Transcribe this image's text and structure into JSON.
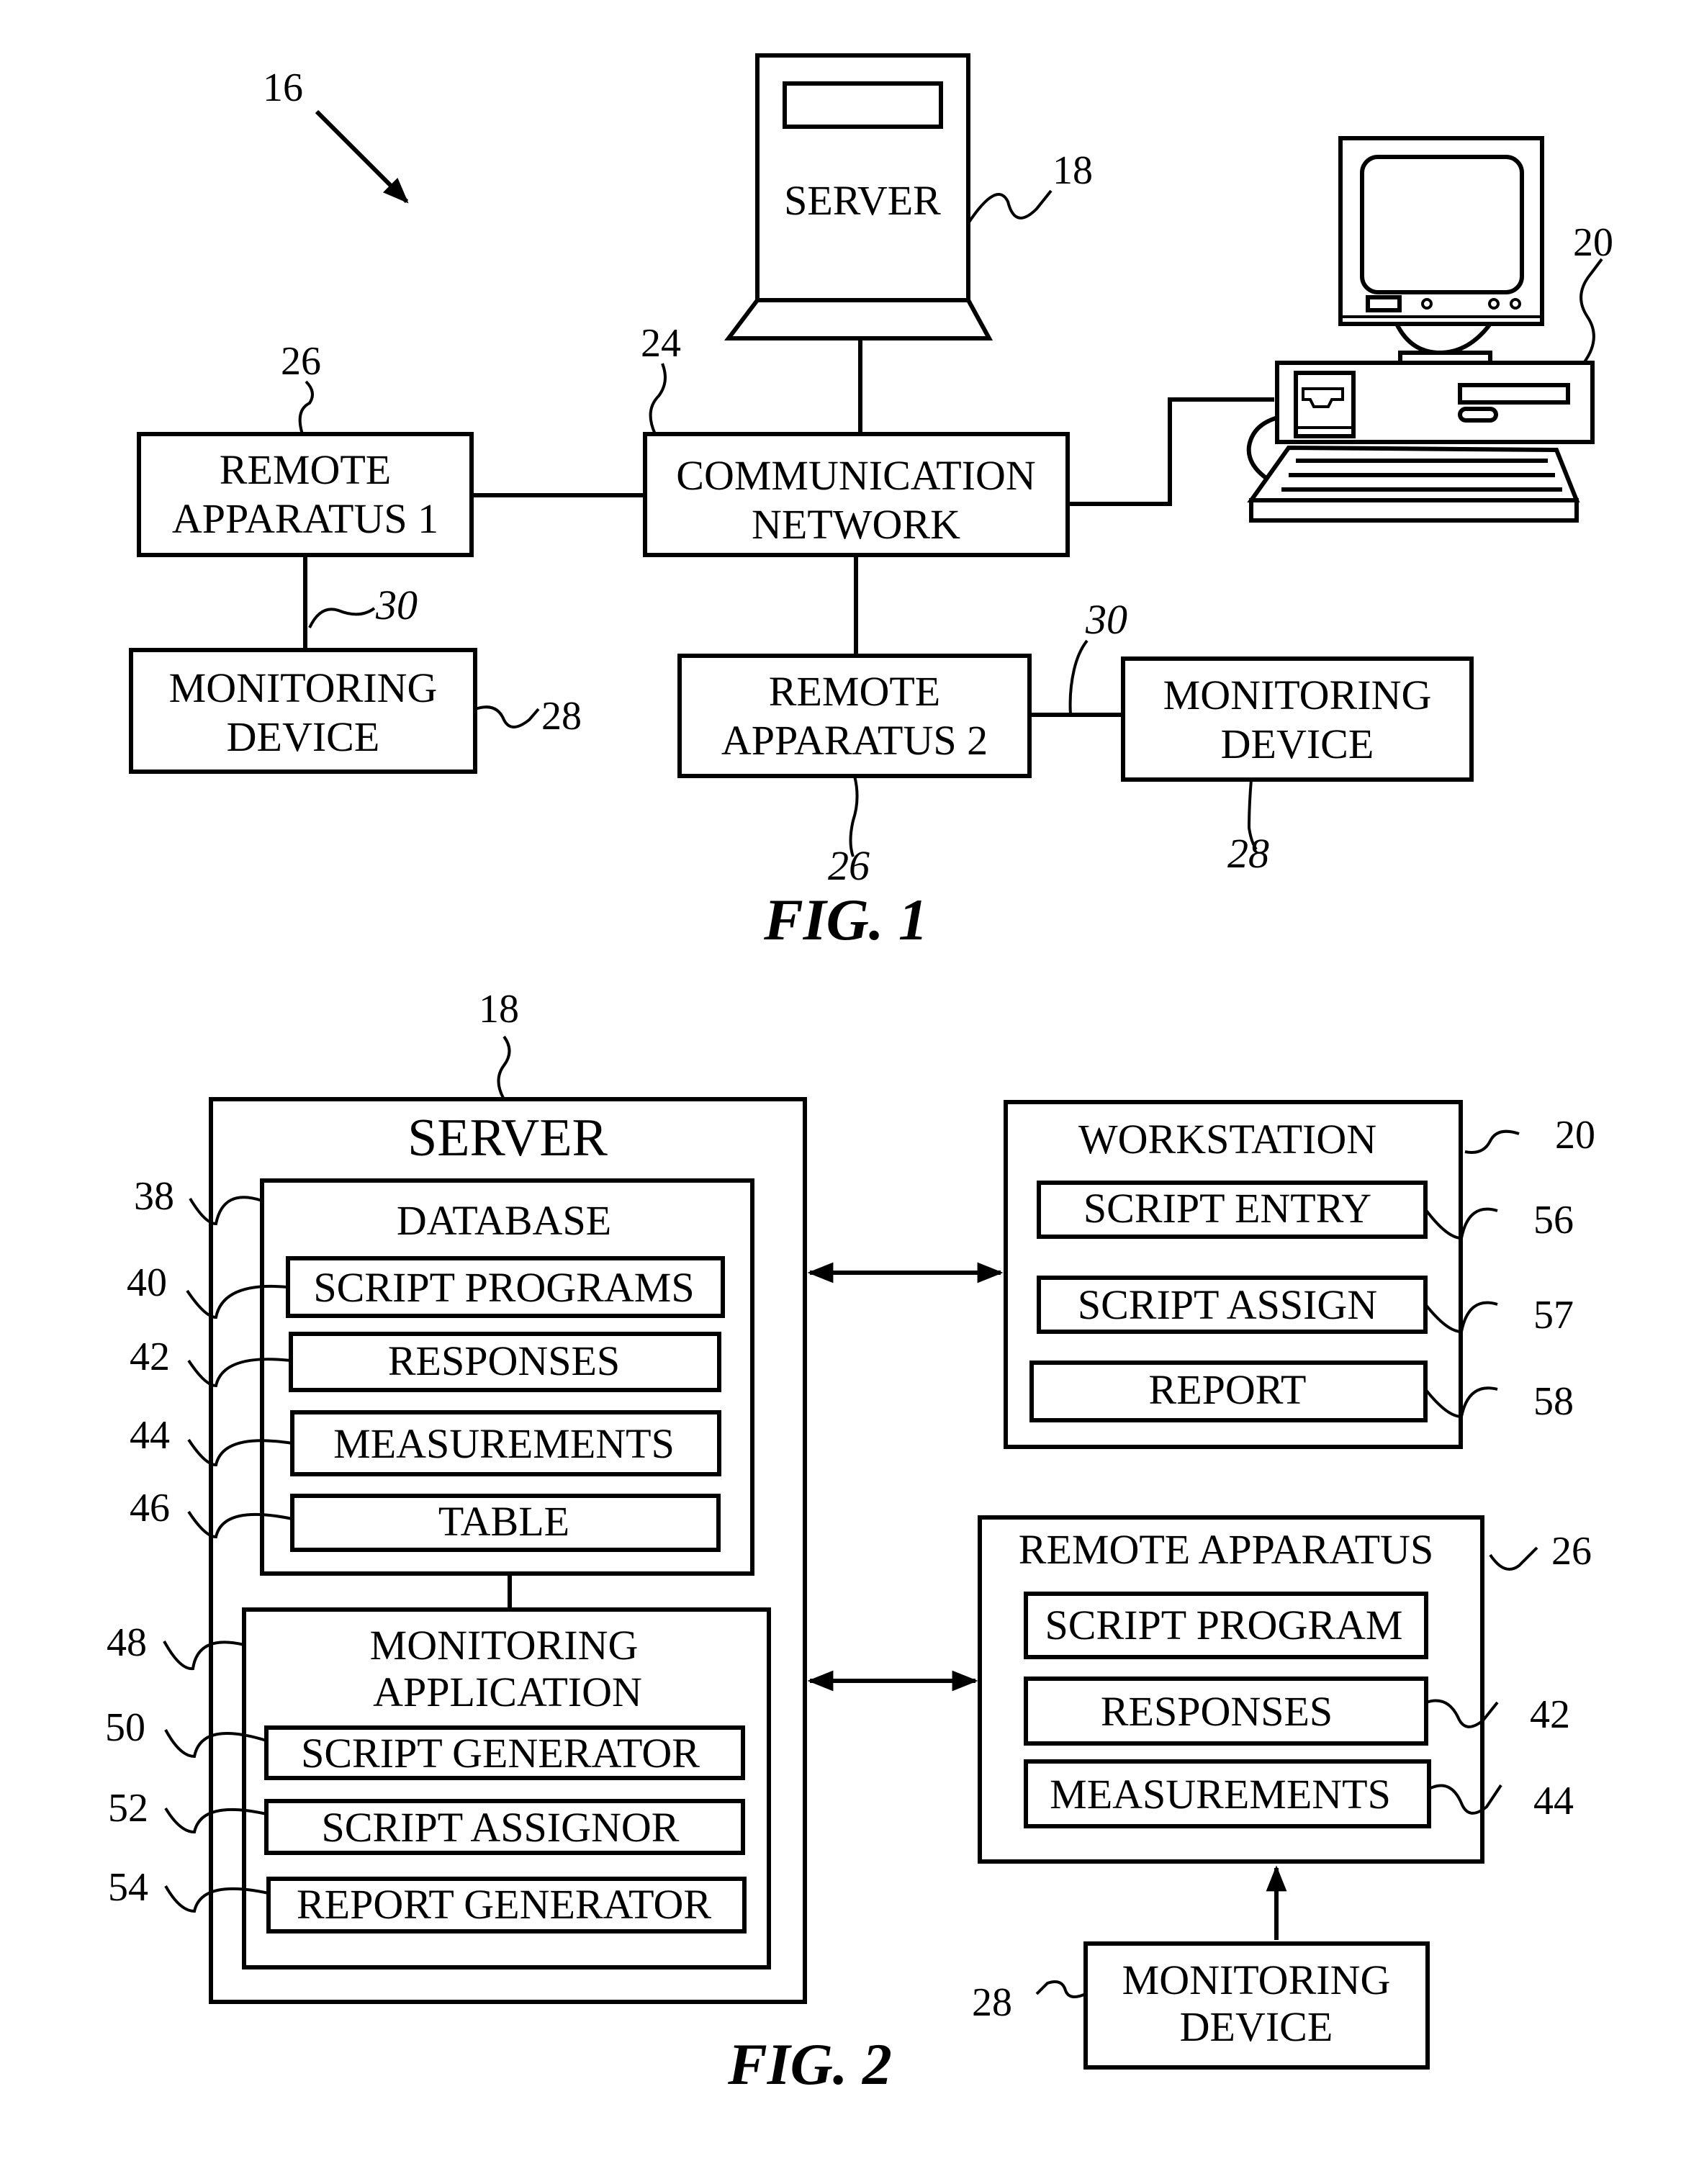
{
  "fig1": {
    "caption": "FIG. 1",
    "system_ref": "16",
    "server": {
      "label": "SERVER",
      "ref": "18"
    },
    "workstation": {
      "ref": "20"
    },
    "network": {
      "line1": "COMMUNICATION",
      "line2": "NETWORK",
      "ref": "24"
    },
    "remote1": {
      "line1": "REMOTE",
      "line2": "APPARATUS 1",
      "ref": "26"
    },
    "remote2": {
      "line1": "REMOTE",
      "line2": "APPARATUS 2",
      "ref": "26"
    },
    "monitor_left": {
      "line1": "MONITORING",
      "line2": "DEVICE",
      "ref": "28",
      "link_ref": "30"
    },
    "monitor_right": {
      "line1": "MONITORING",
      "line2": "DEVICE",
      "ref": "28",
      "link_ref": "30"
    }
  },
  "fig2": {
    "caption": "FIG. 2",
    "server": {
      "title": "SERVER",
      "ref": "18",
      "database": {
        "title": "DATABASE",
        "ref": "38",
        "items": [
          {
            "label": "SCRIPT PROGRAMS",
            "ref": "40"
          },
          {
            "label": "RESPONSES",
            "ref": "42"
          },
          {
            "label": "MEASUREMENTS",
            "ref": "44"
          },
          {
            "label": "TABLE",
            "ref": "46"
          }
        ]
      },
      "monitoring_app": {
        "title_line1": "MONITORING",
        "title_line2": "APPLICATION",
        "ref": "48",
        "items": [
          {
            "label": "SCRIPT GENERATOR",
            "ref": "50"
          },
          {
            "label": "SCRIPT ASSIGNOR",
            "ref": "52"
          },
          {
            "label": "REPORT GENERATOR",
            "ref": "54"
          }
        ]
      }
    },
    "workstation": {
      "title": "WORKSTATION",
      "ref": "20",
      "items": [
        {
          "label": "SCRIPT ENTRY",
          "ref": "56"
        },
        {
          "label": "SCRIPT ASSIGN",
          "ref": "57"
        },
        {
          "label": "REPORT",
          "ref": "58"
        }
      ]
    },
    "remote_apparatus": {
      "title": "REMOTE APPARATUS",
      "ref": "26",
      "items": [
        {
          "label": "SCRIPT PROGRAM",
          "ref": ""
        },
        {
          "label": "RESPONSES",
          "ref": "42"
        },
        {
          "label": "MEASUREMENTS",
          "ref": "44"
        }
      ]
    },
    "monitoring_device": {
      "line1": "MONITORING",
      "line2": "DEVICE",
      "ref": "28"
    }
  }
}
